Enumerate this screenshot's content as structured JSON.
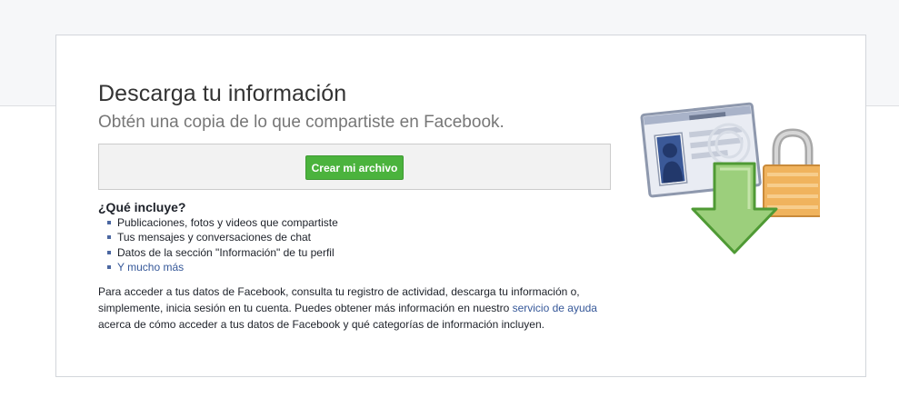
{
  "header": {
    "title": "Descarga tu información",
    "subtitle": "Obtén una copia de lo que compartiste en Facebook."
  },
  "action": {
    "create_label": "Crear mi archivo"
  },
  "includes": {
    "heading": "¿Qué incluye?",
    "items": [
      "Publicaciones, fotos y videos que compartiste",
      "Tus mensajes y conversaciones de chat",
      "Datos de la sección \"Información\" de tu perfil"
    ],
    "more_link": "Y mucho más"
  },
  "description": {
    "text_before": "Para acceder a tus datos de Facebook, consulta tu registro de actividad, descarga tu información o, simplemente, inicia sesión en tu cuenta. Puedes obtener más información en nuestro ",
    "help_link": "servicio de ayuda",
    "text_after": " acerca de cómo acceder a tus datos de Facebook y qué categorías de información incluyen."
  },
  "colors": {
    "button_green": "#4bb33d",
    "link_blue": "#365899",
    "arrow_green": "#8cc56f",
    "lock_orange": "#f0b35d"
  },
  "icons": {
    "illustration": "download-profile-lock-illustration"
  }
}
